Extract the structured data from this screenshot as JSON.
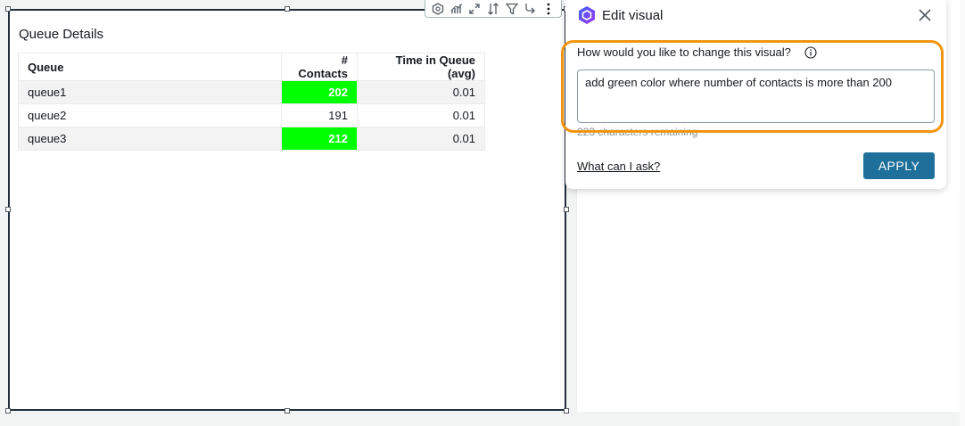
{
  "visual": {
    "title": "Queue Details",
    "table": {
      "headers": [
        "Queue",
        "# Contacts",
        "Time in Queue (avg)"
      ],
      "rows": [
        {
          "queue": "queue1",
          "contacts": "202",
          "time": "0.01",
          "highlight": true
        },
        {
          "queue": "queue2",
          "contacts": "191",
          "time": "0.01",
          "highlight": false
        },
        {
          "queue": "queue3",
          "contacts": "212",
          "time": "0.01",
          "highlight": true
        }
      ],
      "highlight_color": "#00ff00"
    },
    "toolbar_icons": [
      "q-icon",
      "insights-icon",
      "expand-icon",
      "sort-icon",
      "filter-icon",
      "drill-icon",
      "more-menu-icon"
    ]
  },
  "edit_panel": {
    "title": "Edit visual",
    "prompt_label": "How would you like to change this visual?",
    "prompt_value": "add green color where number of contacts is more than 200",
    "chars_remaining": "223 characters remaining",
    "help_link": "What can I ask?",
    "apply_label": "APPLY",
    "accent_color": "#1e6f9a",
    "highlight_ring_color": "#f29511"
  }
}
